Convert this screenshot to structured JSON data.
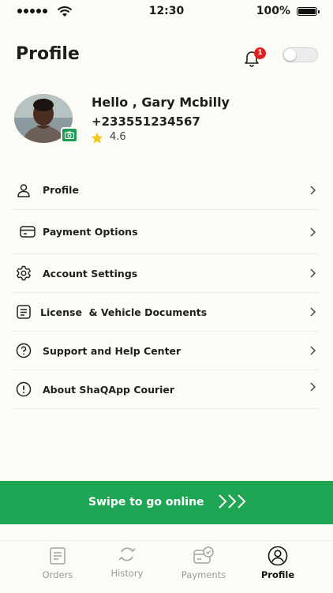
{
  "status_bar": {
    "time": "12:30",
    "battery": "100%"
  },
  "header": {
    "title": "Profile",
    "notification_count": "1",
    "online_toggle_on": false
  },
  "user": {
    "greeting": "Hello , Gary Mcbilly",
    "phone": "+233551234567",
    "rating": "4.6"
  },
  "menu": {
    "items": [
      {
        "label": "Profile",
        "icon": "person-icon"
      },
      {
        "label": "Payment Options",
        "icon": "card-icon"
      },
      {
        "label": "Account Settings",
        "icon": "gear-icon"
      },
      {
        "label": "License  & Vehicle Documents",
        "icon": "document-icon"
      },
      {
        "label": "Support and Help Center",
        "icon": "help-icon"
      },
      {
        "label": "About ShaQApp Courier",
        "icon": "info-icon"
      }
    ]
  },
  "swipe": {
    "label": "Swipe to go online"
  },
  "tabs": [
    {
      "label": "Orders",
      "icon": "orders-icon",
      "active": false
    },
    {
      "label": "History",
      "icon": "history-icon",
      "active": false
    },
    {
      "label": "Payments",
      "icon": "payments-icon",
      "active": false
    },
    {
      "label": "Profile",
      "icon": "profile-icon",
      "active": true
    }
  ],
  "colors": {
    "accent": "#1fa654",
    "badge": "#e02020",
    "background": "#fcfcf6"
  }
}
